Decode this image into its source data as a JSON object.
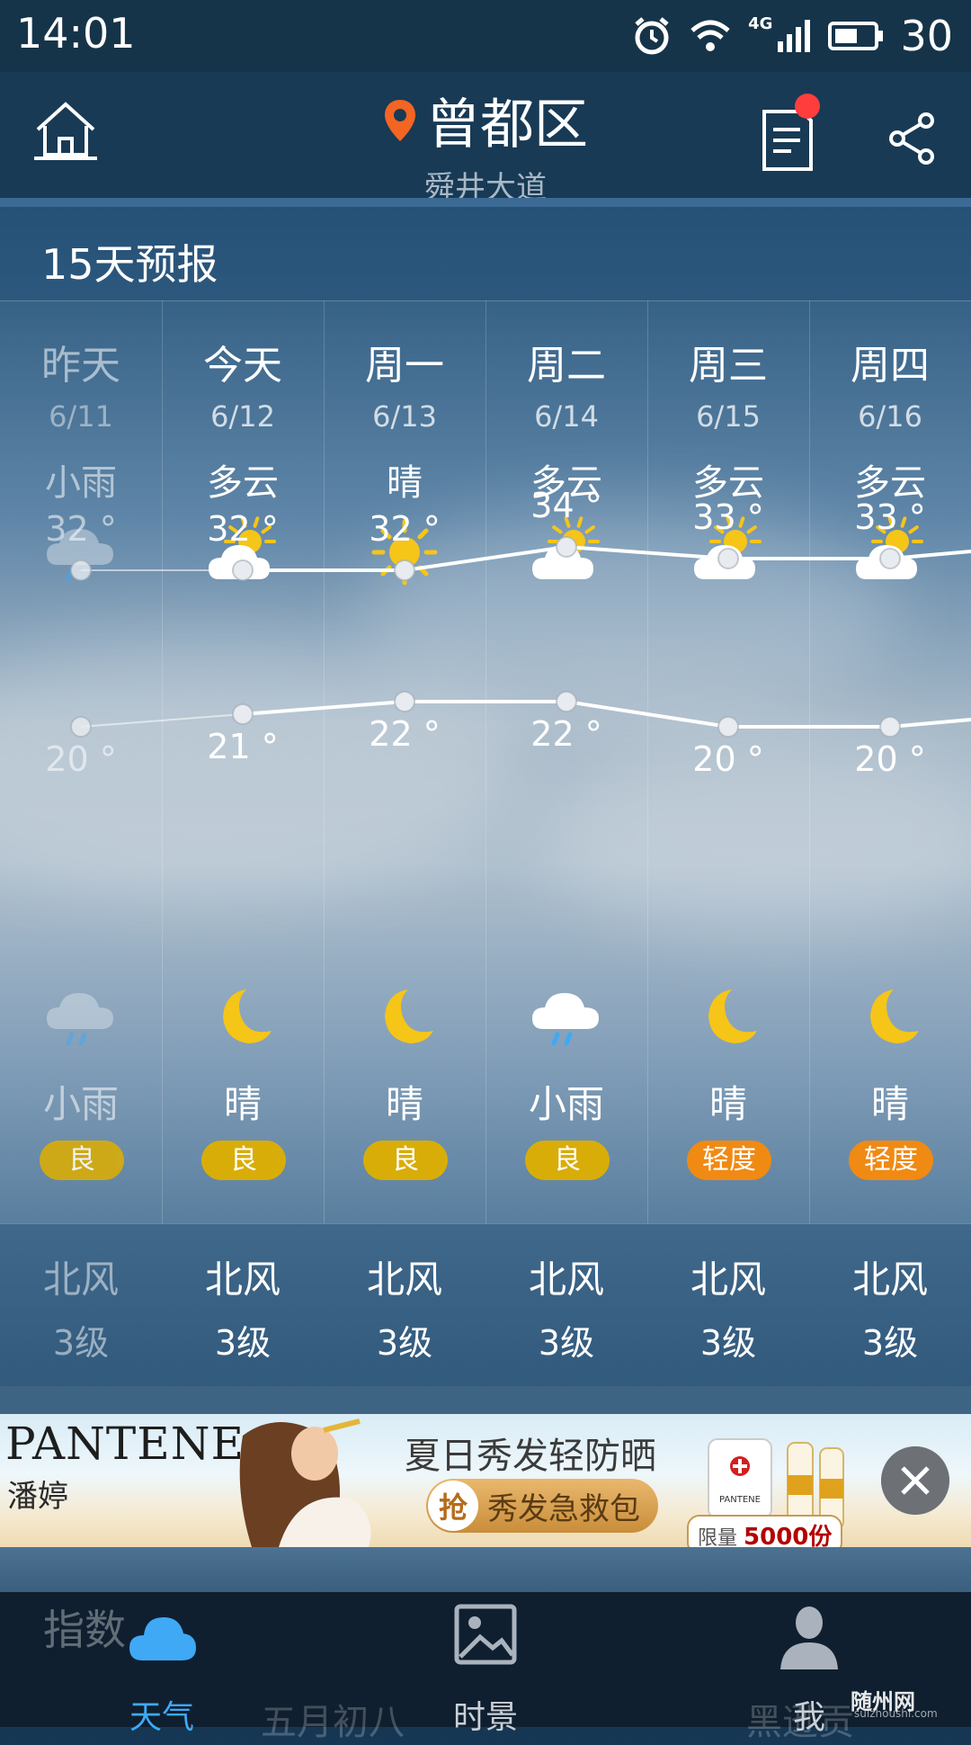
{
  "status": {
    "time": "14:01",
    "network": "4G",
    "battery": "30"
  },
  "header": {
    "city": "曾都区",
    "district": "舜井大道"
  },
  "forecast": {
    "title": "15天预报",
    "days": [
      {
        "name": "昨天",
        "date": "6/11",
        "day_cond": "小雨",
        "day_icon": "rain-cloud-icon",
        "high": "32 °",
        "low": "20 °",
        "night_icon": "rain-cloud-icon",
        "night_cond": "小雨",
        "aqi": "良",
        "aqi_level": "good",
        "wind_dir": "北风",
        "wind_level": "3级",
        "dim": true
      },
      {
        "name": "今天",
        "date": "6/12",
        "day_cond": "多云",
        "day_icon": "partly-cloudy-icon",
        "high": "32 °",
        "low": "21 °",
        "night_icon": "moon-icon",
        "night_cond": "晴",
        "aqi": "良",
        "aqi_level": "good",
        "wind_dir": "北风",
        "wind_level": "3级",
        "dim": false
      },
      {
        "name": "周一",
        "date": "6/13",
        "day_cond": "晴",
        "day_icon": "sun-icon",
        "high": "32 °",
        "low": "22 °",
        "night_icon": "moon-icon",
        "night_cond": "晴",
        "aqi": "良",
        "aqi_level": "good",
        "wind_dir": "北风",
        "wind_level": "3级",
        "dim": false
      },
      {
        "name": "周二",
        "date": "6/14",
        "day_cond": "多云",
        "day_icon": "partly-cloudy-icon",
        "high": "34 °",
        "low": "22 °",
        "night_icon": "rain-cloud-icon",
        "night_cond": "小雨",
        "aqi": "良",
        "aqi_level": "good",
        "wind_dir": "北风",
        "wind_level": "3级",
        "dim": false
      },
      {
        "name": "周三",
        "date": "6/15",
        "day_cond": "多云",
        "day_icon": "partly-cloudy-icon",
        "high": "33 °",
        "low": "20 °",
        "night_icon": "moon-icon",
        "night_cond": "晴",
        "aqi": "轻度",
        "aqi_level": "light",
        "wind_dir": "北风",
        "wind_level": "3级",
        "dim": false
      },
      {
        "name": "周四",
        "date": "6/16",
        "day_cond": "多云",
        "day_icon": "partly-cloudy-icon",
        "high": "33 °",
        "low": "20 °",
        "night_icon": "moon-icon",
        "night_cond": "晴",
        "aqi": "轻度",
        "aqi_level": "light",
        "wind_dir": "北风",
        "wind_level": "3级",
        "dim": false
      }
    ]
  },
  "chart_data": {
    "type": "line",
    "categories": [
      "6/11",
      "6/12",
      "6/13",
      "6/14",
      "6/15",
      "6/16"
    ],
    "series": [
      {
        "values": [
          32,
          32,
          32,
          34,
          33,
          33
        ]
      },
      {
        "values": [
          20,
          21,
          22,
          22,
          20,
          20
        ]
      }
    ]
  },
  "ad": {
    "brand": "PANTENE",
    "brand_cn": "潘婷",
    "headline": "夏日秀发轻防晒",
    "cta_badge": "抢",
    "cta": "秀发急救包",
    "product_label": "PANTENE",
    "limit_prefix": "限量",
    "limit_value": "5000份"
  },
  "bottom": {
    "index_label": "指数",
    "under_left": "五月初八",
    "under_right": "黑逊贡"
  },
  "tabs": [
    {
      "label": "天气",
      "icon": "cloud-icon",
      "active": true
    },
    {
      "label": "时景",
      "icon": "picture-icon",
      "active": false
    },
    {
      "label": "我",
      "icon": "user-icon",
      "active": false
    }
  ],
  "watermark": {
    "main": "随州网",
    "sub": "suizhoushi.com"
  },
  "colors": {
    "aqi_good": "#d9ad08",
    "aqi_light": "#f08a13",
    "tab_active": "#3fa9f5",
    "sun": "#f5c518",
    "pin": "#f26522"
  }
}
